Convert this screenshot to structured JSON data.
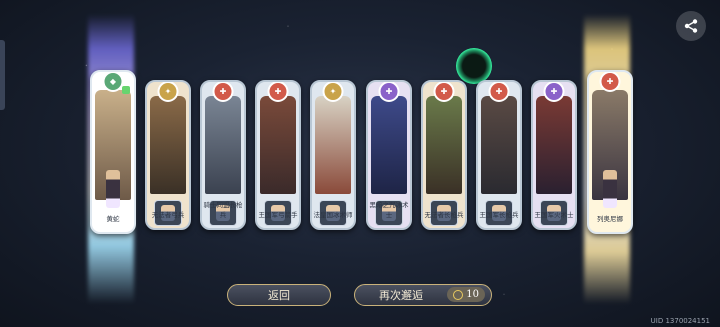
{
  "cards": [
    {
      "name": "黄蛇",
      "bg": "#ffffff",
      "badge_color": "#5aa876",
      "badge_glyph": "◆",
      "is_new": true,
      "art": [
        "#c9b08a",
        "#6e5a48"
      ]
    },
    {
      "name": "无法者弓兵",
      "bg": "#efe3cd",
      "badge_color": "#c9a34a",
      "badge_glyph": "✦",
      "is_new": false,
      "art": [
        "#8a6a48",
        "#3a3026"
      ]
    },
    {
      "name": "骑士同盟长枪兵",
      "bg": "#dfe7ef",
      "badge_color": "#d25a4a",
      "badge_glyph": "✚",
      "is_new": false,
      "art": [
        "#7a8594",
        "#3b4250"
      ]
    },
    {
      "name": "王国军弓箭手",
      "bg": "#dfe7ef",
      "badge_color": "#d25a4a",
      "badge_glyph": "✚",
      "is_new": false,
      "art": [
        "#7a4a3a",
        "#3a2a2a"
      ]
    },
    {
      "name": "法皇国冰术师",
      "bg": "#dfe7ef",
      "badge_color": "#c9a34a",
      "badge_glyph": "✦",
      "is_new": false,
      "art": [
        "#d8d2c4",
        "#8a4a3a"
      ]
    },
    {
      "name": "黑暗之咒冰术士",
      "bg": "#e6e0f2",
      "badge_color": "#8a62c9",
      "badge_glyph": "✚",
      "is_new": false,
      "art": [
        "#3e4a8a",
        "#1e2446"
      ]
    },
    {
      "name": "无法者长枪兵",
      "bg": "#efe3cd",
      "badge_color": "#d25a4a",
      "badge_glyph": "✚",
      "is_new": false,
      "art": [
        "#6a7a4a",
        "#3a3026"
      ]
    },
    {
      "name": "王国军长枪兵",
      "bg": "#dfe7ef",
      "badge_color": "#d25a4a",
      "badge_glyph": "✚",
      "is_new": false,
      "art": [
        "#5a4a44",
        "#2a2a30"
      ]
    },
    {
      "name": "王国军火术士",
      "bg": "#e6e0f2",
      "badge_color": "#8a62c9",
      "badge_glyph": "✚",
      "is_new": false,
      "art": [
        "#7a3a34",
        "#2a2030"
      ]
    },
    {
      "name": "列奥尼娜",
      "bg": "#fff6dc",
      "badge_color": "#d25a4a",
      "badge_glyph": "✚",
      "is_new": false,
      "art": [
        "#8a7a68",
        "#3a3440"
      ]
    }
  ],
  "buttons": {
    "back": "返回",
    "again": "再次邂逅",
    "cost": "10"
  },
  "uid": "UID 1370024151",
  "colors": {
    "accent_gold": "#c9b27a",
    "glow_green": "#36f0a0"
  }
}
